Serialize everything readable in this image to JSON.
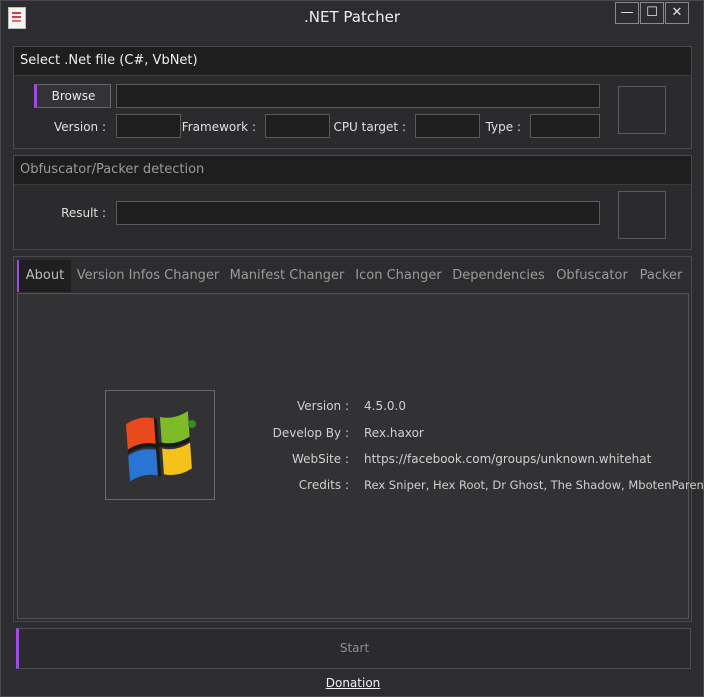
{
  "window": {
    "title": ".NET Patcher",
    "min_glyph": "—",
    "max_glyph": "☐",
    "close_glyph": "✕"
  },
  "file_panel": {
    "title": "Select .Net file (C#, VbNet)",
    "browse_label": "Browse",
    "path_value": "",
    "version_label": "Version :",
    "version_value": "",
    "framework_label": "Framework :",
    "framework_value": "",
    "cpu_label": "CPU target :",
    "cpu_value": "",
    "type_label": "Type :",
    "type_value": ""
  },
  "detect_panel": {
    "title": "Obfuscator/Packer detection",
    "result_label": "Result :",
    "result_value": ""
  },
  "tabs": [
    {
      "label": "About"
    },
    {
      "label": "Version Infos Changer"
    },
    {
      "label": "Manifest Changer"
    },
    {
      "label": "Icon Changer"
    },
    {
      "label": "Dependencies"
    },
    {
      "label": "Obfuscator"
    },
    {
      "label": "Packer"
    }
  ],
  "about": {
    "version_label": "Version :",
    "version_value": "4.5.0.0",
    "develop_label": "Develop By :",
    "develop_value": "Rex.haxor",
    "website_label": "WebSite :",
    "website_value": "https://facebook.com/groups/unknown.whitehat",
    "credits_label": "Credits :",
    "credits_value": "Rex Sniper, Hex Root, Dr Ghost, The Shadow, MbotenPareng"
  },
  "start_label": "Start",
  "donation_label": "Donation",
  "colors": {
    "accent": "#9b4de0",
    "background": "#2d2d30",
    "header": "#1e1e1e"
  }
}
